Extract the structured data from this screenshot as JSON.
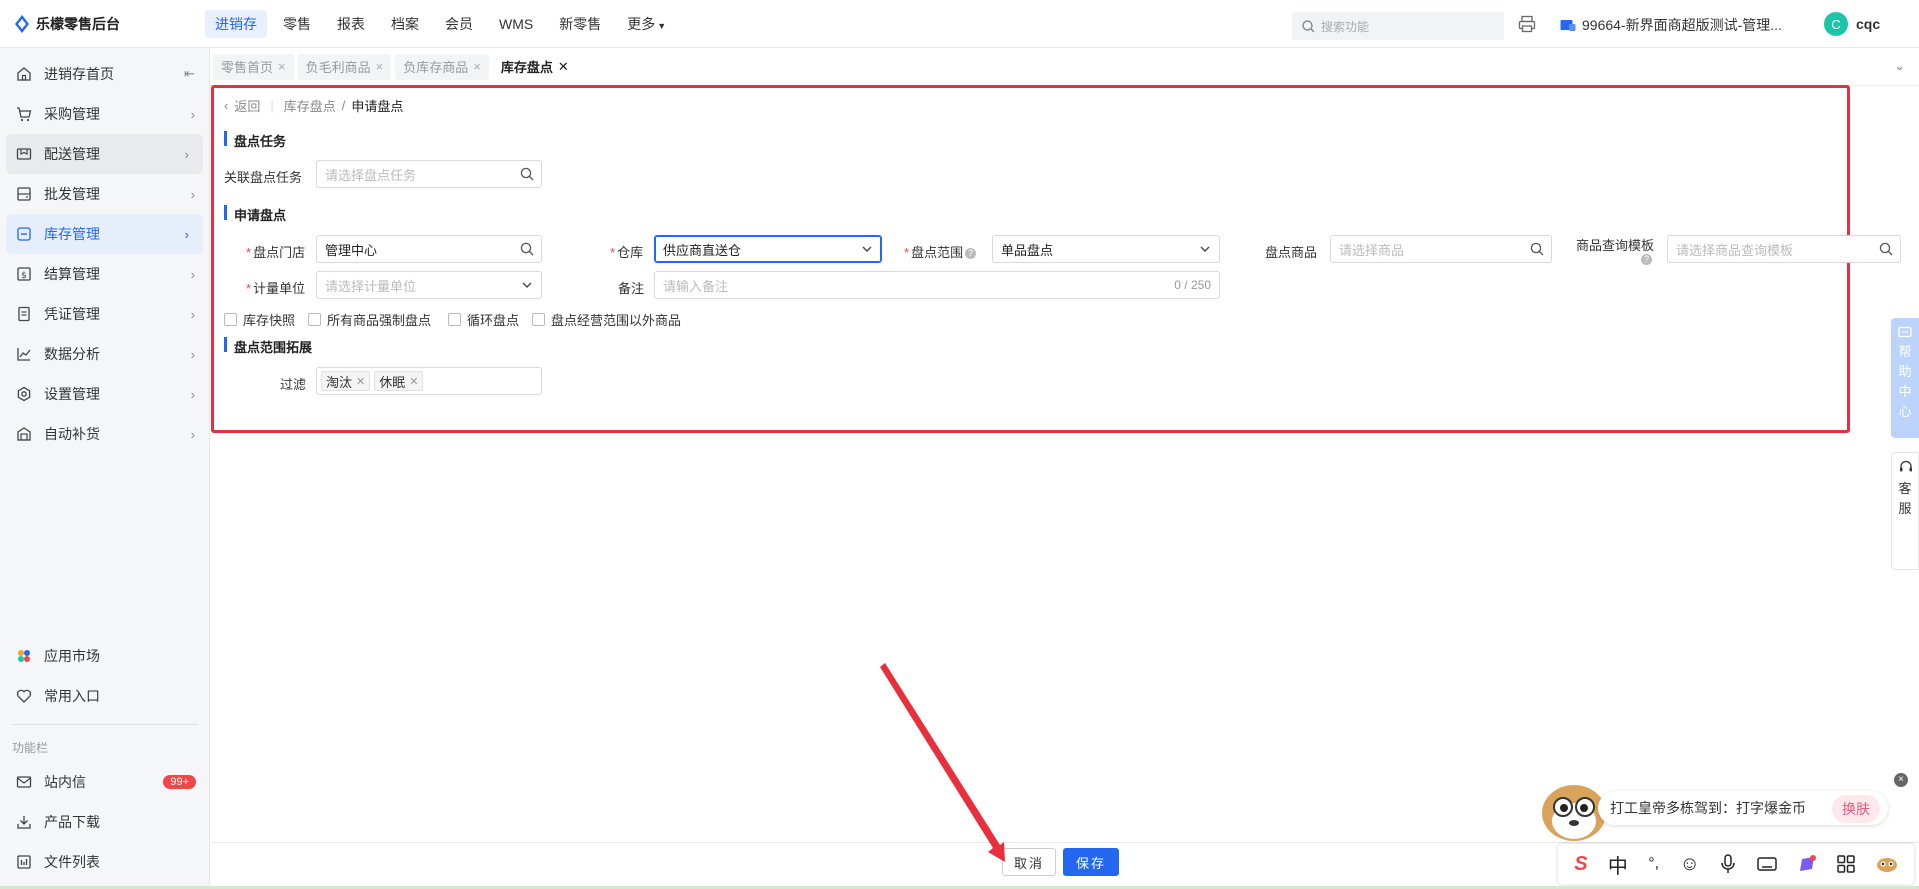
{
  "app": {
    "title": "乐檬零售后台"
  },
  "topnav": {
    "items": [
      "进销存",
      "零售",
      "报表",
      "档案",
      "会员",
      "WMS",
      "新零售",
      "更多"
    ],
    "search_placeholder": "搜索功能",
    "store": "99664-新界面商超版测试-管理...",
    "user_initial": "C",
    "user_name": "cqc"
  },
  "sidebar": {
    "items": [
      {
        "label": "进销存首页",
        "icon": "home-icon"
      },
      {
        "label": "采购管理",
        "icon": "cart-icon"
      },
      {
        "label": "配送管理",
        "icon": "delivery-icon"
      },
      {
        "label": "批发管理",
        "icon": "wholesale-icon"
      },
      {
        "label": "库存管理",
        "icon": "inventory-icon"
      },
      {
        "label": "结算管理",
        "icon": "settlement-icon"
      },
      {
        "label": "凭证管理",
        "icon": "voucher-icon"
      },
      {
        "label": "数据分析",
        "icon": "chart-icon"
      },
      {
        "label": "设置管理",
        "icon": "settings-icon"
      },
      {
        "label": "自动补货",
        "icon": "replenish-icon"
      }
    ],
    "bottom": {
      "app_market": "应用市场",
      "favorites": "常用入口",
      "section": "功能栏",
      "messages": "站内信",
      "messages_badge": "99+",
      "downloads": "产品下载",
      "files": "文件列表"
    }
  },
  "tabs": [
    "零售首页",
    "负毛利商品",
    "负库存商品",
    "库存盘点"
  ],
  "breadcrumb": {
    "back": "返回",
    "parent": "库存盘点",
    "sep": "/",
    "current": "申请盘点"
  },
  "form": {
    "section_task": "盘点任务",
    "task_label": "关联盘点任务",
    "task_placeholder": "请选择盘点任务",
    "section_apply": "申请盘点",
    "store_label": "盘点门店",
    "store_value": "管理中心",
    "warehouse_label": "仓库",
    "warehouse_value": "供应商直送仓",
    "scope_label": "盘点范围",
    "scope_value": "单品盘点",
    "goods_label": "盘点商品",
    "goods_placeholder": "请选择商品",
    "template_label": "商品查询模板",
    "template_placeholder": "请选择商品查询模板",
    "unit_label": "计量单位",
    "unit_placeholder": "请选择计量单位",
    "remark_label": "备注",
    "remark_placeholder": "请输入备注",
    "remark_counter": "0 / 250",
    "checkboxes": [
      "库存快照",
      "所有商品强制盘点",
      "循环盘点",
      "盘点经营范围以外商品"
    ],
    "section_ext": "盘点范围拓展",
    "filter_label": "过滤",
    "filter_tags": [
      "淘汰",
      "休眠"
    ]
  },
  "footer": {
    "cancel": "取消",
    "save": "保存"
  },
  "side_float": {
    "help": [
      "帮",
      "助",
      "中",
      "心"
    ],
    "cs": [
      "客",
      "服"
    ]
  },
  "ime": {
    "tip": "打工皇帝多栋驾到：打字爆金币",
    "skin": "换肤",
    "lang": "中",
    "punct": "°,"
  },
  "colors": {
    "accent": "#2468f2",
    "highlight_box": "#e8303d",
    "badge": "#f04848"
  }
}
